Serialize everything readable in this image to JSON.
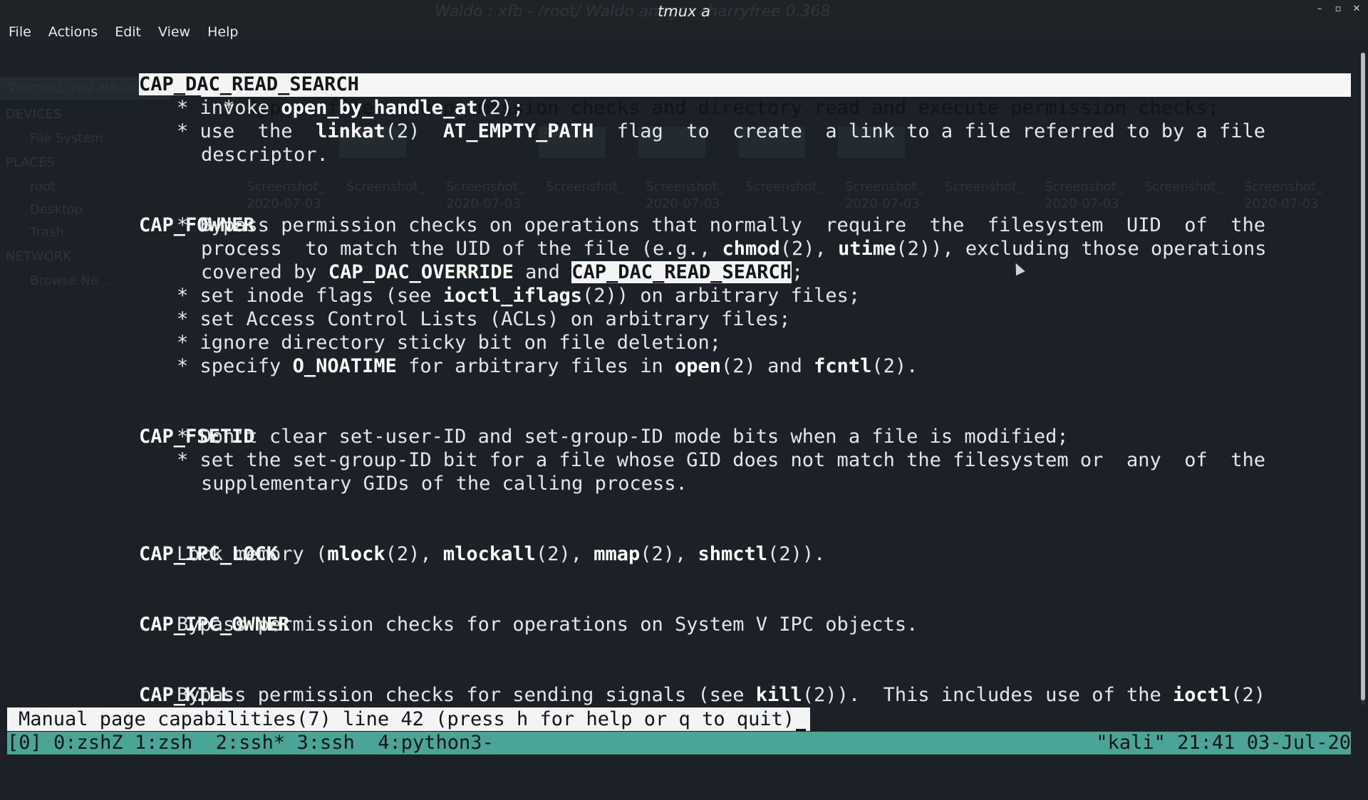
{
  "window": {
    "title": "tmux a",
    "ghost_title": "Waldo : xfb - /root/   Waldo   anager   charryfree 0.368"
  },
  "menu": [
    "File",
    "Actions",
    "Edit",
    "View",
    "Help"
  ],
  "ghost_sidebar": {
    "warning": "Warning, you are using t",
    "devices": "DEVICES",
    "filesystem": "File System",
    "places": "PLACES",
    "root": "root",
    "desktop": "Desktop",
    "trash": "Trash",
    "network": "NETWORK",
    "browse": "Browse Ne...",
    "tile_label": "Screenshot_",
    "tile_date": "2020-07-03"
  },
  "man": {
    "sections": [
      {
        "name": "CAP_DAC_READ_SEARCH",
        "lines": [
          "Bypass file read permission checks and directory read and execute permission checks;",
          "invoke open_by_handle_at(2);",
          "use  the  linkat(2)  AT_EMPTY_PATH  flag  to  create  a link to a file referred to by a file",
          "descriptor."
        ]
      },
      {
        "name": "CAP_FOWNER",
        "lines": [
          "Bypass permission checks on operations that normally  require  the  filesystem  UID  of  the",
          "process  to match the UID of the file (e.g., chmod(2), utime(2)), excluding those operations",
          "covered by CAP_DAC_OVERRIDE and CAP_DAC_READ_SEARCH;",
          "set inode flags (see ioctl_iflags(2)) on arbitrary files;",
          "set Access Control Lists (ACLs) on arbitrary files;",
          "ignore directory sticky bit on file deletion;",
          "specify O_NOATIME for arbitrary files in open(2) and fcntl(2)."
        ]
      },
      {
        "name": "CAP_FSETID",
        "lines": [
          "Don't clear set-user-ID and set-group-ID mode bits when a file is modified;",
          "set the set-group-ID bit for a file whose GID does not match the filesystem or  any  of  the",
          "supplementary GIDs of the calling process."
        ]
      },
      {
        "name": "CAP_IPC_LOCK",
        "lines": [
          "Lock memory (mlock(2), mlockall(2), mmap(2), shmctl(2))."
        ]
      },
      {
        "name": "CAP_IPC_OWNER",
        "lines": [
          "Bypass permission checks for operations on System V IPC objects."
        ]
      },
      {
        "name": "CAP_KILL",
        "lines": [
          "Bypass permission checks for sending signals (see kill(2)).  This includes use of the ioctl(2)"
        ]
      }
    ]
  },
  "pager_prompt": "Manual page capabilities(7) line 42 (press h for help or q to quit)",
  "tmux": {
    "session": "[0]",
    "windows": [
      "0:zshZ",
      "1:zsh",
      "2:ssh*",
      "3:ssh",
      "4:python3-"
    ],
    "host": "\"kali\"",
    "time": "21:41",
    "date": "03-Jul-20"
  },
  "colors": {
    "background": "#1c2127",
    "status_bar": "#4aa597",
    "highlight": "#f4f4f4"
  }
}
